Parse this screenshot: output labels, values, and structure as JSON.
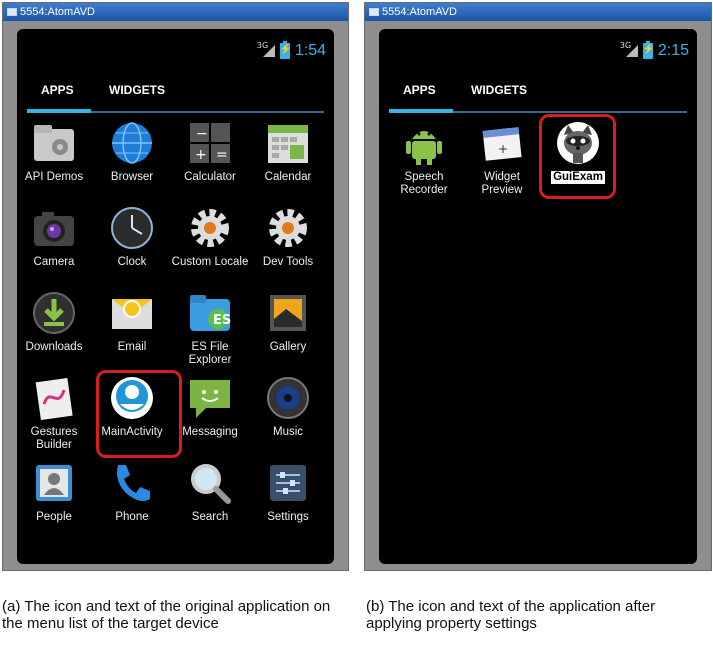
{
  "left_panel": {
    "window_title": "5554:AtomAVD",
    "status": {
      "network": "3G",
      "time": "1:54"
    },
    "tabs": [
      "APPS",
      "WIDGETS"
    ],
    "apps": [
      {
        "label": "API Demos",
        "icon": "folder-gear-icon"
      },
      {
        "label": "Browser",
        "icon": "globe-icon"
      },
      {
        "label": "Calculator",
        "icon": "calculator-icon"
      },
      {
        "label": "Calendar",
        "icon": "calendar-icon"
      },
      {
        "label": "Camera",
        "icon": "camera-icon"
      },
      {
        "label": "Clock",
        "icon": "clock-icon"
      },
      {
        "label": "Custom Locale",
        "icon": "gear-icon"
      },
      {
        "label": "Dev Tools",
        "icon": "gear-icon"
      },
      {
        "label": "Downloads",
        "icon": "download-icon"
      },
      {
        "label": "Email",
        "icon": "email-icon"
      },
      {
        "label": "ES File Explorer",
        "icon": "folder-icon"
      },
      {
        "label": "Gallery",
        "icon": "gallery-icon"
      },
      {
        "label": "Gestures Builder",
        "icon": "gestures-icon"
      },
      {
        "label": "MainActivity",
        "icon": "android-face-icon"
      },
      {
        "label": "Messaging",
        "icon": "message-icon"
      },
      {
        "label": "Music",
        "icon": "music-icon"
      },
      {
        "label": "People",
        "icon": "contacts-icon"
      },
      {
        "label": "Phone",
        "icon": "phone-icon"
      },
      {
        "label": "Search",
        "icon": "magnifier-icon"
      },
      {
        "label": "Settings",
        "icon": "settings-sliders-icon"
      }
    ]
  },
  "right_panel": {
    "window_title": "5554:AtomAVD",
    "status": {
      "network": "3G",
      "time": "2:15"
    },
    "tabs": [
      "APPS",
      "WIDGETS"
    ],
    "apps": [
      {
        "label": "Speech Recorder",
        "icon": "android-robot-icon"
      },
      {
        "label": "Widget Preview",
        "icon": "widget-preview-icon"
      },
      {
        "label": "GuiExam",
        "icon": "raccoon-icon"
      }
    ]
  },
  "captions": {
    "a": "(a) The icon and text of the original application on the menu list of the target device",
    "b": "(b) The icon and text of the application after applying property settings"
  },
  "colors": {
    "accent": "#33b5e5",
    "highlight": "#d91c1c",
    "screen_bg": "#000000"
  }
}
